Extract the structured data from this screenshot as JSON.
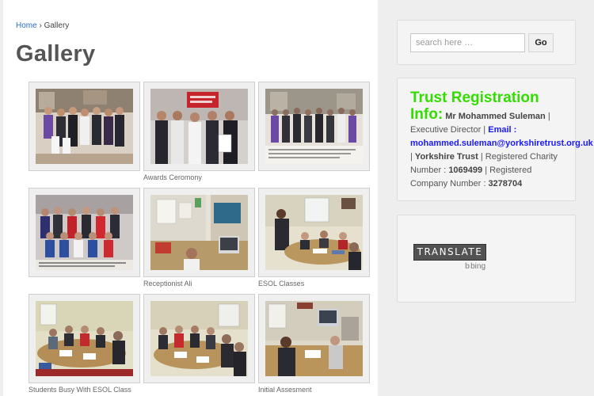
{
  "breadcrumb": {
    "home": "Home",
    "separator": "›",
    "current": "Gallery"
  },
  "page": {
    "title": "Gallery"
  },
  "gallery": {
    "items": [
      {
        "caption": ""
      },
      {
        "caption": "Awards Ceromony"
      },
      {
        "caption": ""
      },
      {
        "caption": ""
      },
      {
        "caption": "Receptionist Ali"
      },
      {
        "caption": "ESOL Classes"
      },
      {
        "caption": "Students Busy With ESOL Class"
      },
      {
        "caption": ""
      },
      {
        "caption": "Initial Assesment"
      }
    ]
  },
  "search": {
    "placeholder": "search here …",
    "button_label": "Go"
  },
  "trust_info": {
    "heading": "Trust Registration Info:",
    "name": "Mr Mohammed Suleman",
    "role": "| Executive Director |",
    "email_label": "Email :",
    "email": "mohammed.suleman@yorkshiretrust.org.uk",
    "org": "Yorkshire Trust",
    "charity_label": "| Registered Charity Number :",
    "charity_number": "1069499",
    "company_label": "| Registered Company Number :",
    "company_number": "3278704"
  },
  "translate": {
    "button_label": "TRANSLATE",
    "provider": "bing"
  },
  "colors": {
    "accent_green": "#33dd00",
    "link_blue": "#1a1aff",
    "breadcrumb_link": "#2a6fc9"
  }
}
